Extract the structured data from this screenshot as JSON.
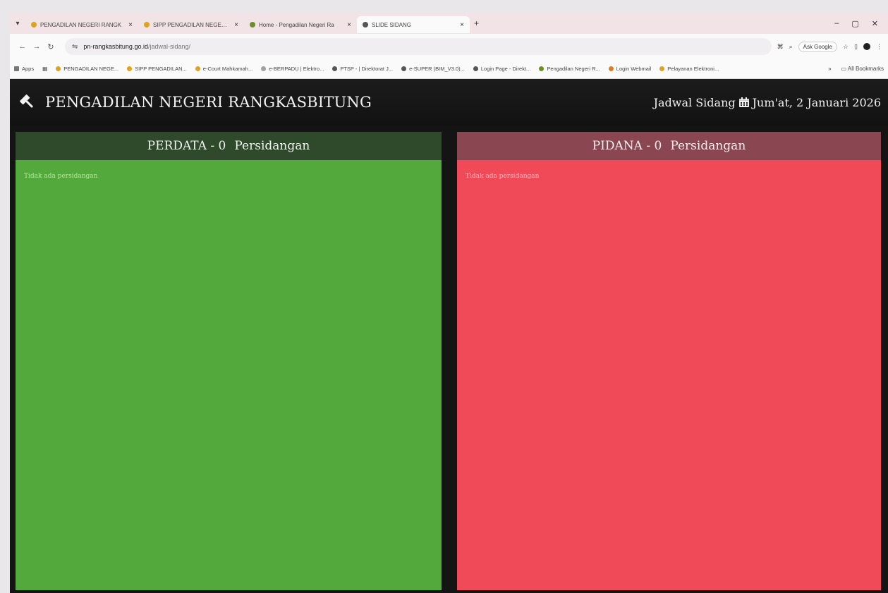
{
  "browser": {
    "tabs": [
      {
        "label": "PENGADILAN NEGERI RANGK",
        "active": false,
        "color": "#e0a21a"
      },
      {
        "label": "SIPP PENGADILAN NEGERI RA",
        "active": false,
        "color": "#e0a21a"
      },
      {
        "label": "Home - Pengadilan Negeri Ra",
        "active": false,
        "color": "#6a8f2a"
      },
      {
        "label": "SLIDE SIDANG",
        "active": true,
        "color": "#555555"
      }
    ],
    "new_tab": "+",
    "url_domain": "pn-rangkasbitung.go.id",
    "url_path": "/jadwal-sidang/",
    "ask_google": "Ask Google",
    "bookmarks": [
      {
        "label": "Apps",
        "color": "#777777"
      },
      {
        "label": "PENGADILAN NEGE...",
        "color": "#e0a21a"
      },
      {
        "label": "SIPP PENGADILAN...",
        "color": "#e0a21a"
      },
      {
        "label": "e-Court Mahkamah...",
        "color": "#e0a21a"
      },
      {
        "label": "e-BERPADU | Elektro...",
        "color": "#a0a0a0"
      },
      {
        "label": "PTSP - | Direktorat J...",
        "color": "#555555"
      },
      {
        "label": "e-SUPER (BIM_V3.0)...",
        "color": "#555555"
      },
      {
        "label": "Login Page - Direkt...",
        "color": "#555555"
      },
      {
        "label": "Pengadilan Negeri R...",
        "color": "#6a8f2a"
      },
      {
        "label": "Login Webmail",
        "color": "#e07a1a"
      },
      {
        "label": "Pelayanan Elektroni...",
        "color": "#e0a21a"
      }
    ],
    "all_bookmarks": "All Bookmarks"
  },
  "header": {
    "title": "PENGADILAN NEGERI RANGKASBITUNG",
    "schedule_label": "Jadwal Sidang",
    "date": "Jum'at, 2 Januari 2026"
  },
  "panels": {
    "perdata": {
      "name": "PERDATA - 0",
      "suffix": "Persidangan",
      "empty": "Tidak ada persidangan",
      "color": "#54a93d"
    },
    "pidana": {
      "name": "PIDANA - 0",
      "suffix": "Persidangan",
      "empty": "Tidak ada persidangan",
      "color": "#f04958"
    }
  }
}
